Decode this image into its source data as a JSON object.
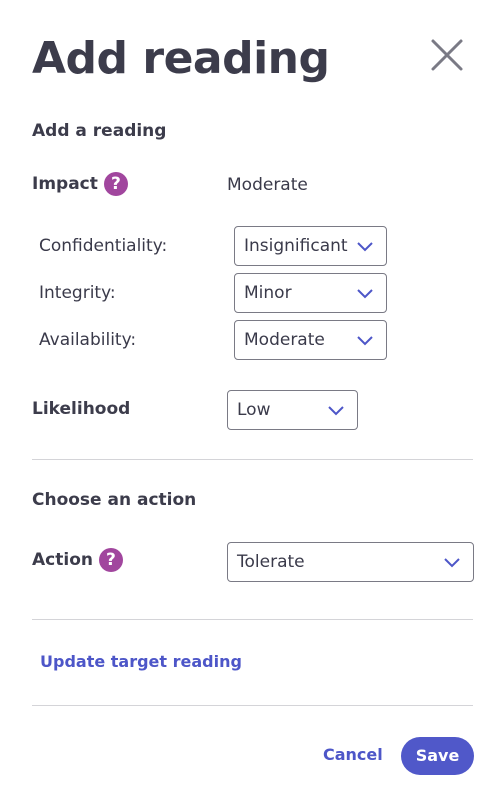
{
  "dialog": {
    "title": "Add reading",
    "close_icon": "close-icon"
  },
  "reading_section": {
    "heading": "Add a reading",
    "impact": {
      "label": "Impact",
      "help_glyph": "?",
      "value": "Moderate"
    },
    "confidentiality": {
      "label": "Confidentiality:",
      "selected": "Insignificant"
    },
    "integrity": {
      "label": "Integrity:",
      "selected": "Minor"
    },
    "availability": {
      "label": "Availability:",
      "selected": "Moderate"
    },
    "likelihood": {
      "label": "Likelihood",
      "selected": "Low"
    }
  },
  "action_section": {
    "heading": "Choose an action",
    "action": {
      "label": "Action",
      "help_glyph": "?",
      "selected": "Tolerate"
    }
  },
  "links": {
    "update_target": "Update target reading"
  },
  "footer": {
    "cancel_label": "Cancel",
    "save_label": "Save"
  },
  "colors": {
    "accent": "#5058c9",
    "help_icon": "#a1469e",
    "text": "#3a3a4a"
  }
}
